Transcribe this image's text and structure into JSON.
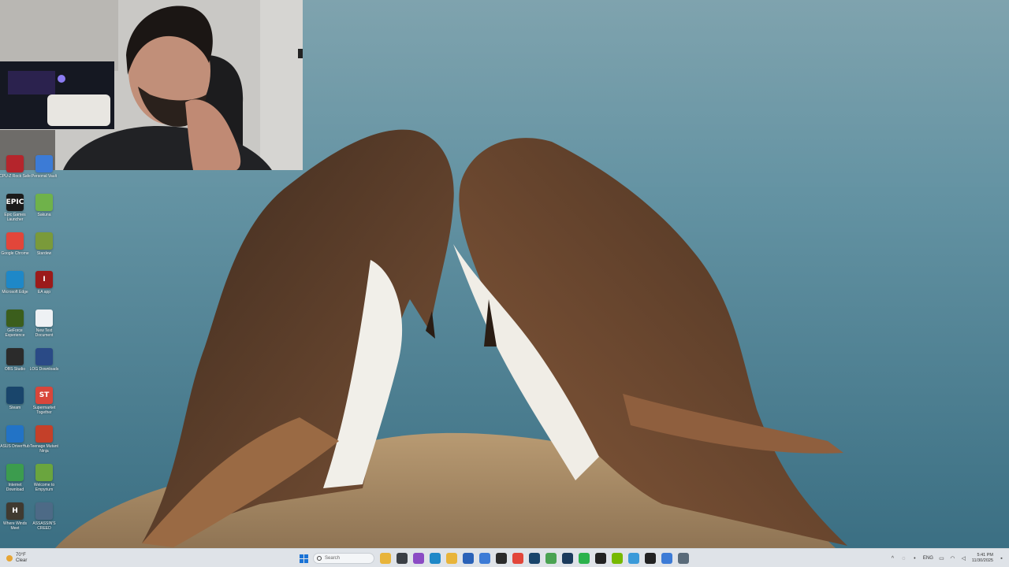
{
  "desktop_icons": [
    {
      "label": "CPU-Z Rock Safe",
      "color": "#b5252c",
      "glyph": "",
      "col": 0,
      "row": -1
    },
    {
      "label": "Personal Vault",
      "color": "#3c7bd6",
      "glyph": "",
      "col": 1,
      "row": -1
    },
    {
      "label": "Epic Games Launcher",
      "color": "#1b1b1b",
      "glyph": "EPIC",
      "col": 0,
      "row": 0
    },
    {
      "label": "Sakuna",
      "color": "#6fb24a",
      "glyph": "",
      "col": 1,
      "row": 0
    },
    {
      "label": "Google Chrome",
      "color": "#e2463a",
      "glyph": "",
      "col": 0,
      "row": 1
    },
    {
      "label": "Stardew",
      "color": "#7a9a3a",
      "glyph": "",
      "col": 1,
      "row": 1
    },
    {
      "label": "Microsoft Edge",
      "color": "#1e88c8",
      "glyph": "",
      "col": 0,
      "row": 2
    },
    {
      "label": "EA app",
      "color": "#9b1a1a",
      "glyph": "I",
      "col": 1,
      "row": 2
    },
    {
      "label": "GeForce Experience",
      "color": "#3b5e1c",
      "glyph": "",
      "col": 0,
      "row": 3
    },
    {
      "label": "New Text Document",
      "color": "#eef1f4",
      "glyph": "",
      "col": 1,
      "row": 3
    },
    {
      "label": "OBS Studio",
      "color": "#2b2b2b",
      "glyph": "",
      "col": 0,
      "row": 4
    },
    {
      "label": "LOG Downloads",
      "color": "#2a4a86",
      "glyph": "",
      "col": 1,
      "row": 4
    },
    {
      "label": "Steam",
      "color": "#19456b",
      "glyph": "",
      "col": 0,
      "row": 5
    },
    {
      "label": "Supermarket Together",
      "color": "#d8463b",
      "glyph": "ST",
      "col": 1,
      "row": 5
    },
    {
      "label": "ASUS DriverHub",
      "color": "#2273c6",
      "glyph": "",
      "col": 0,
      "row": 6
    },
    {
      "label": "Teenage Mutant Ninja",
      "color": "#c44029",
      "glyph": "",
      "col": 1,
      "row": 6
    },
    {
      "label": "Internet Download",
      "color": "#3c9c4e",
      "glyph": "",
      "col": 0,
      "row": 7
    },
    {
      "label": "Welcome to Empyrium",
      "color": "#6aa53e",
      "glyph": "",
      "col": 1,
      "row": 7
    },
    {
      "label": "Where Winds Meet",
      "color": "#403a30",
      "glyph": "H",
      "col": 0,
      "row": 8
    },
    {
      "label": "ASSASSIN'S CREED",
      "color": "#4d6a86",
      "glyph": "",
      "col": 1,
      "row": 8
    }
  ],
  "taskbar": {
    "weather_temp": "70°F",
    "weather_desc": "Clear",
    "search_placeholder": "Search",
    "apps": [
      {
        "name": "file-explorer",
        "color": "#e8b43a",
        "glyph": ""
      },
      {
        "name": "task-view",
        "color": "#3a3f45",
        "glyph": ""
      },
      {
        "name": "app-purple",
        "color": "#8b4bc4",
        "glyph": ""
      },
      {
        "name": "edge",
        "color": "#1e88c8",
        "glyph": ""
      },
      {
        "name": "folder",
        "color": "#e8b43a",
        "glyph": ""
      },
      {
        "name": "store",
        "color": "#2a62b8",
        "glyph": ""
      },
      {
        "name": "app-blue",
        "color": "#3c7bd6",
        "glyph": ""
      },
      {
        "name": "obs",
        "color": "#2b2b2b",
        "glyph": ""
      },
      {
        "name": "chrome",
        "color": "#e2463a",
        "glyph": ""
      },
      {
        "name": "steam",
        "color": "#19456b",
        "glyph": ""
      },
      {
        "name": "app-green",
        "color": "#4aa352",
        "glyph": ""
      },
      {
        "name": "steam-2",
        "color": "#1b3b5c",
        "glyph": ""
      },
      {
        "name": "whatsapp",
        "color": "#2bb24c",
        "glyph": ""
      },
      {
        "name": "terminal",
        "color": "#222",
        "glyph": ""
      },
      {
        "name": "nvidia",
        "color": "#76b900",
        "glyph": ""
      },
      {
        "name": "notepad",
        "color": "#3a9ad9",
        "glyph": ""
      },
      {
        "name": "app-dark",
        "color": "#222",
        "glyph": ""
      },
      {
        "name": "app-monitor",
        "color": "#3c7bd6",
        "glyph": ""
      },
      {
        "name": "app-network",
        "color": "#5a6b7a",
        "glyph": ""
      }
    ],
    "tray_lang": "ENG",
    "time": "5:41 PM",
    "date": "11/30/2025"
  }
}
